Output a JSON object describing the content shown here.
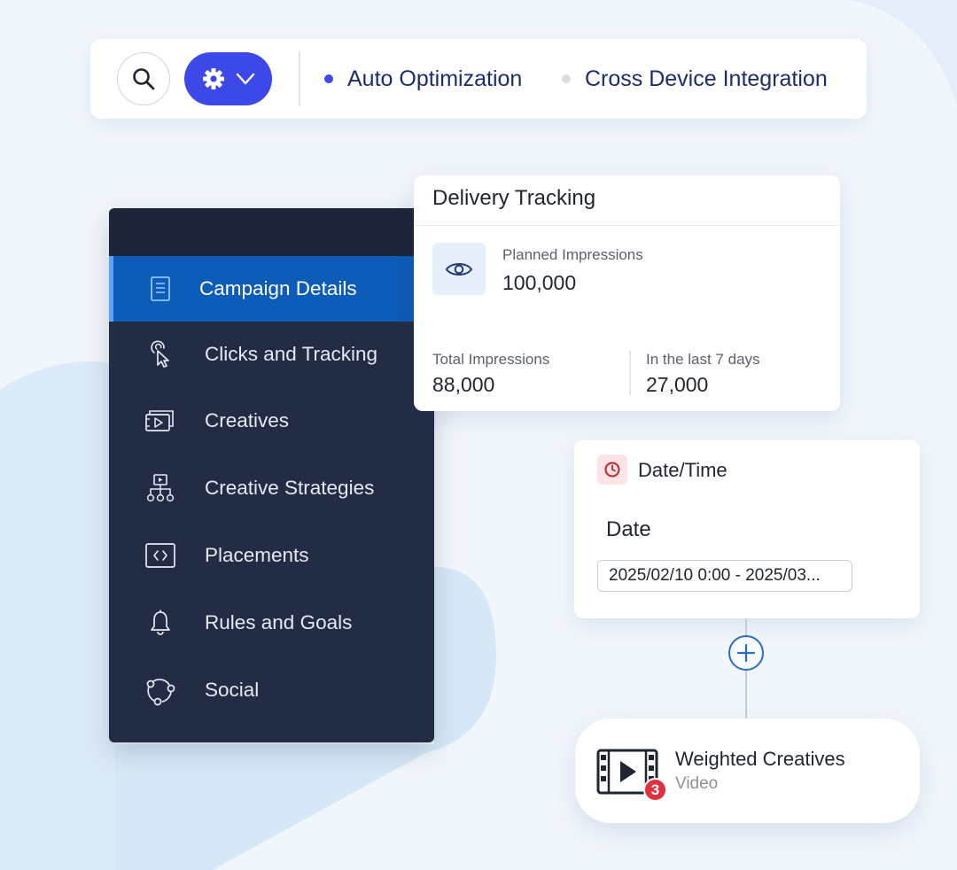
{
  "colors": {
    "accent": "#3c48e8",
    "sidebar_bg": "#232c45",
    "sidebar_active": "#0d5cb8",
    "badge": "#e0323e"
  },
  "toolbar": {
    "search_icon": "search-icon",
    "settings_icon": "gear-icon",
    "features": [
      {
        "label": "Auto Optimization",
        "active": true
      },
      {
        "label": "Cross Device Integration",
        "active": false
      }
    ]
  },
  "sidebar": {
    "items": [
      {
        "label": "Campaign Details",
        "icon": "document-icon",
        "active": true
      },
      {
        "label": "Clicks and Tracking",
        "icon": "cursor-click-icon",
        "active": false
      },
      {
        "label": "Creatives",
        "icon": "creatives-icon",
        "active": false
      },
      {
        "label": "Creative Strategies",
        "icon": "hierarchy-icon",
        "active": false
      },
      {
        "label": "Placements",
        "icon": "code-box-icon",
        "active": false
      },
      {
        "label": "Rules and Goals",
        "icon": "bell-icon",
        "active": false
      },
      {
        "label": "Social",
        "icon": "social-network-icon",
        "active": false
      }
    ]
  },
  "delivery": {
    "title": "Delivery Tracking",
    "planned_label": "Planned Impressions",
    "planned_value": "100,000",
    "total_label": "Total Impressions",
    "total_value": "88,000",
    "last7_label": "In the last 7 days",
    "last7_value": "27,000"
  },
  "datetime": {
    "title": "Date/Time",
    "date_label": "Date",
    "date_value": "2025/02/10 0:00 - 2025/03..."
  },
  "weighted": {
    "title": "Weighted Creatives",
    "subtitle": "Video",
    "badge_count": "3"
  }
}
